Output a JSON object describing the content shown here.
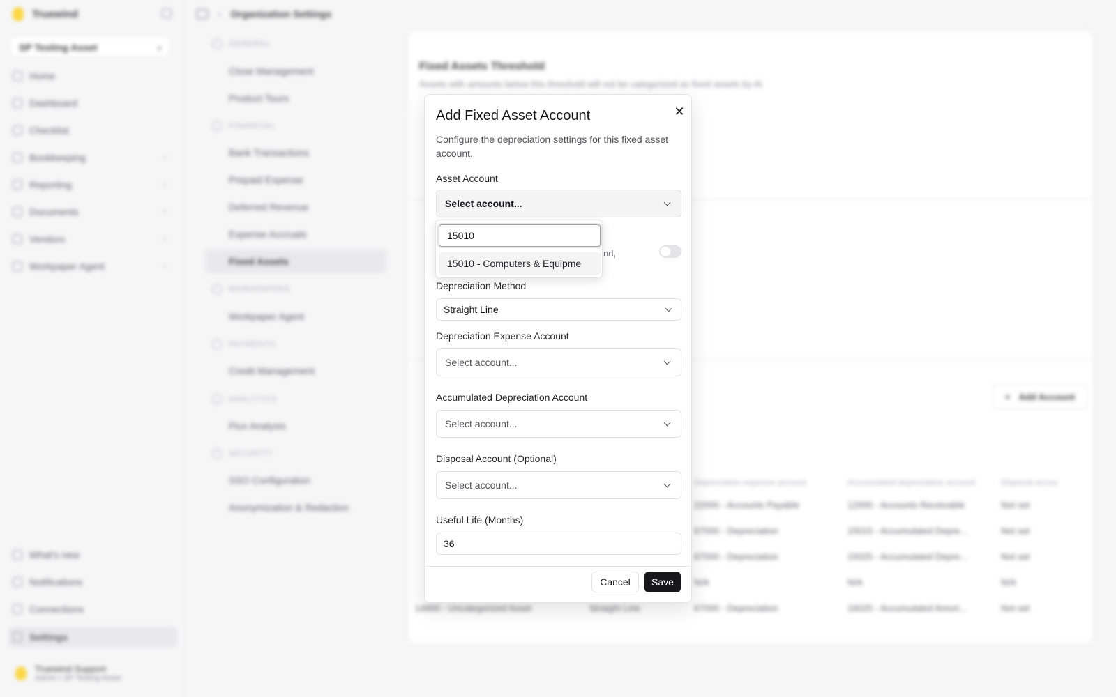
{
  "app": {
    "brand": "Truewind",
    "org": "SP Testing Asset",
    "breadcrumb": "Organization Settings",
    "nav": [
      {
        "label": "Home",
        "chev": ""
      },
      {
        "label": "Dashboard",
        "chev": ""
      },
      {
        "label": "Checklist",
        "chev": ""
      },
      {
        "label": "Bookkeeping",
        "chev": "›"
      },
      {
        "label": "Reporting",
        "chev": "›"
      },
      {
        "label": "Documents",
        "chev": "›"
      },
      {
        "label": "Vendors",
        "chev": "›"
      },
      {
        "label": "Workpaper Agent",
        "chev": "›"
      }
    ],
    "nav_bottom": [
      "What's new",
      "Notifications",
      "Connections",
      "Settings"
    ],
    "user": {
      "name": "Truewind Support",
      "role": "Admin • SP Testing Asset"
    }
  },
  "settings_nav": {
    "sections": [
      {
        "title": "GENERAL",
        "items": [
          "Close Management",
          "Product Tours"
        ]
      },
      {
        "title": "FINANCIAL",
        "items": [
          "Bank Transactions",
          "Prepaid Expense",
          "Deferred Revenue",
          "Expense Accruals",
          "Fixed Assets"
        ]
      },
      {
        "title": "WORKPAPERS",
        "items": [
          "Workpaper Agent"
        ]
      },
      {
        "title": "PAYMENTS",
        "items": [
          "Credit Management"
        ]
      },
      {
        "title": "ANALYTICS",
        "items": [
          "Flux Analysis"
        ]
      },
      {
        "title": "SECURITY",
        "items": [
          "SSO Configuration",
          "Anonymization & Redaction"
        ]
      }
    ]
  },
  "content": {
    "threshold_title": "Fixed Assets Threshold",
    "threshold_desc": "Assets with amounts below this threshold will not be categorized as fixed assets by AI",
    "add_account": "Add Account",
    "table_headers": [
      "Depreciation expense account",
      "Accumulated depreciation account",
      "Disposal accou"
    ],
    "rows": [
      [
        "",
        "",
        "22000 - Accounts Payable",
        "12000 - Accounts Receivable",
        "Not set"
      ],
      [
        "",
        "",
        "67000 - Depreciation",
        "15015 - Accumulated Depre...",
        "Not set"
      ],
      [
        "",
        "",
        "67000 - Depreciation",
        "15025 - Accumulated Depre...",
        "Not set"
      ],
      [
        "",
        "",
        "N/A",
        "N/A",
        "N/A"
      ],
      [
        "14900 - Uncategorized Asset",
        "Straight Line",
        "67000 - Depreciation",
        "16025 - Accumulated Amort...",
        "Not set"
      ]
    ]
  },
  "modal": {
    "title": "Add Fixed Asset Account",
    "description": "Configure the depreciation settings for this fixed asset account.",
    "asset_account_label": "Asset Account",
    "asset_account_value": "Select account...",
    "partial_text": "nd,",
    "depreciation_method_label": "Depreciation Method",
    "depreciation_method_value": "Straight Line",
    "expense_account_label": "Depreciation Expense Account",
    "expense_account_value": "Select account...",
    "accumulated_label": "Accumulated Depreciation Account",
    "accumulated_value": "Select account...",
    "disposal_label": "Disposal Account (Optional)",
    "disposal_value": "Select account...",
    "useful_life_label": "Useful Life (Months)",
    "useful_life_value": "36",
    "cancel": "Cancel",
    "save": "Save"
  },
  "dropdown": {
    "search_value": "15010",
    "option": "15010 - Computers & Equipme"
  }
}
